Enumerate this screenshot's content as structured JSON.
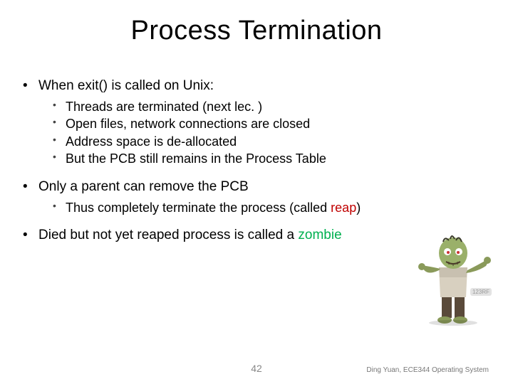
{
  "title": "Process Termination",
  "bullets": {
    "b1": {
      "text": "When exit() is called on Unix:",
      "sub": {
        "s1": "Threads are terminated (next lec. )",
        "s2": "Open files, network connections are closed",
        "s3": "Address space is de-allocated",
        "s4": "But the PCB still remains in the Process Table"
      }
    },
    "b2": {
      "text": "Only a parent can remove the PCB",
      "sub": {
        "s1_pre": "Thus completely terminate the process (called ",
        "s1_reap": "reap",
        "s1_post": ")"
      }
    },
    "b3": {
      "pre": "Died but not yet reaped process is called a ",
      "zombie": "zombie"
    }
  },
  "page_number": "42",
  "footer": "Ding Yuan, ECE344 Operating System",
  "watermark": "123RF"
}
